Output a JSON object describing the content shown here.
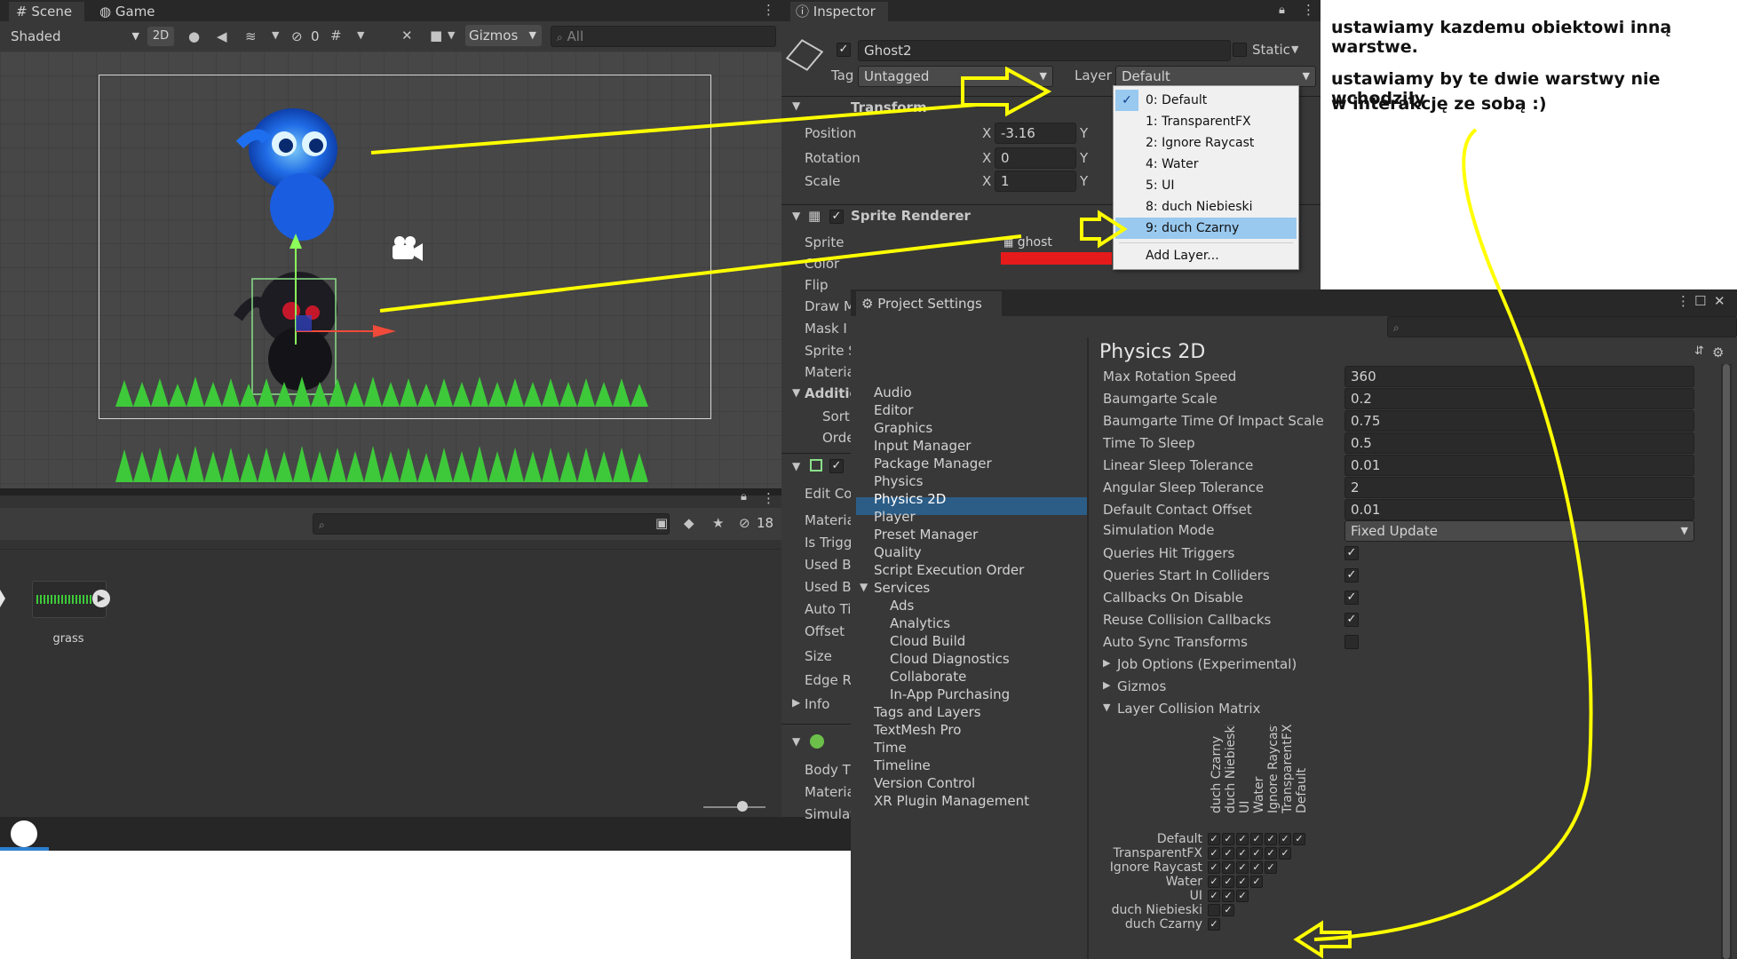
{
  "scene": {
    "tab_scene": "Scene",
    "tab_game": "Game",
    "shading": "Shaded",
    "mode_2d": "2D",
    "hidden_count": "0",
    "gizmos": "Gizmos",
    "search_placeholder": "All"
  },
  "project": {
    "hidden_count": "18",
    "asset_name": "grass"
  },
  "inspector": {
    "tab_label": "Inspector",
    "object_name": "Ghost2",
    "static_label": "Static",
    "tag_label": "Tag",
    "tag_value": "Untagged",
    "layer_label": "Layer",
    "layer_value": "Default",
    "transform": {
      "title": "Transform",
      "position_label": "Position",
      "rotation_label": "Rotation",
      "scale_label": "Scale",
      "axis_x": "X",
      "axis_y": "Y",
      "position_x": "-3.16",
      "rotation_x": "0",
      "scale_x": "1"
    },
    "sprite_renderer": {
      "title": "Sprite Renderer",
      "sprite_label": "Sprite",
      "sprite_value": "ghost",
      "color_label": "Color",
      "color_value": "#e51b1b",
      "flip_label": "Flip",
      "truncated_labels": [
        "Draw M",
        "Mask I",
        "Sprite S",
        "Materia"
      ],
      "additional_label": "Additio",
      "sorting_labels": [
        "Sorti",
        "Orde"
      ]
    },
    "collider_labels": [
      "Edit Co",
      "Materia",
      "Is Trigg",
      "Used B",
      "Used B",
      "Auto Ti",
      "Offset",
      "Size",
      "Edge R",
      "Info"
    ],
    "rigidbody_labels": [
      "Body T",
      "Materia",
      "Simulat"
    ],
    "layer_menu": [
      "0: Default",
      "1: TransparentFX",
      "2: Ignore Raycast",
      "4: Water",
      "5: UI",
      "8: duch Niebieski",
      "9: duch Czarny",
      "Add Layer..."
    ],
    "layer_menu_checked_index": 0,
    "layer_menu_highlight_index": 6
  },
  "project_settings": {
    "title": "Project Settings",
    "sidebar": [
      "Audio",
      "Editor",
      "Graphics",
      "Input Manager",
      "Package Manager",
      "Physics",
      "Physics 2D",
      "Player",
      "Preset Manager",
      "Quality",
      "Script Execution Order",
      "Services",
      "Ads",
      "Analytics",
      "Cloud Build",
      "Cloud Diagnostics",
      "Collaborate",
      "In-App Purchasing",
      "Tags and Layers",
      "TextMesh Pro",
      "Time",
      "Timeline",
      "Version Control",
      "XR Plugin Management"
    ],
    "selected_index": 6,
    "heading": "Physics 2D",
    "values": [
      {
        "label": "Max Rotation Speed",
        "value": "360"
      },
      {
        "label": "Baumgarte Scale",
        "value": "0.2"
      },
      {
        "label": "Baumgarte Time Of Impact Scale",
        "value": "0.75"
      },
      {
        "label": "Time To Sleep",
        "value": "0.5"
      },
      {
        "label": "Linear Sleep Tolerance",
        "value": "0.01"
      },
      {
        "label": "Angular Sleep Tolerance",
        "value": "2"
      },
      {
        "label": "Default Contact Offset",
        "value": "0.01"
      }
    ],
    "simulation_mode_label": "Simulation Mode",
    "simulation_mode_value": "Fixed Update",
    "toggles": [
      {
        "label": "Queries Hit Triggers",
        "checked": true
      },
      {
        "label": "Queries Start In Colliders",
        "checked": true
      },
      {
        "label": "Callbacks On Disable",
        "checked": true
      },
      {
        "label": "Reuse Collision Callbacks",
        "checked": true
      },
      {
        "label": "Auto Sync Transforms",
        "checked": false
      }
    ],
    "foldouts": [
      "Job Options (Experimental)",
      "Gizmos",
      "Layer Collision Matrix"
    ],
    "matrix_columns": [
      "duch Czarny",
      "duch Niebieski",
      "UI",
      "Water",
      "Ignore Raycast",
      "TransparentFX",
      "Default"
    ],
    "matrix_rows": [
      "Default",
      "TransparentFX",
      "Ignore Raycast",
      "Water",
      "UI",
      "duch Niebieski",
      "duch Czarny"
    ],
    "matrix": [
      [
        true,
        true,
        true,
        true,
        true,
        true,
        true
      ],
      [
        true,
        true,
        true,
        true,
        true,
        true
      ],
      [
        true,
        true,
        true,
        true,
        true
      ],
      [
        true,
        true,
        true,
        true
      ],
      [
        true,
        true,
        true
      ],
      [
        false,
        true
      ],
      [
        true
      ]
    ]
  },
  "annotations": {
    "note1": "ustawiamy kazdemu obiektowi inną warstwe.",
    "note2_line1": "ustawiamy by te dwie warstwy nie wchodziły",
    "note2_line2": "w interakcję ze sobą :)"
  },
  "colors": {
    "accent_blue": "#2c5d87",
    "menu_highlight": "#99c9ef",
    "arrow_yellow": "#ffff00"
  }
}
